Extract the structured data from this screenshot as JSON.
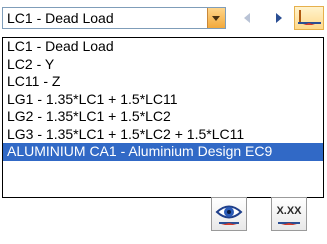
{
  "combo": {
    "selected": "LC1 - Dead Load"
  },
  "dropdown": {
    "items": [
      "LC1 - Dead Load",
      "LC2 - Y",
      "LC11 - Z",
      "LG1 - 1.35*LC1 + 1.5*LC11",
      "LG2 - 1.35*LC1 + 1.5*LC2",
      "LG3 - 1.35*LC1 + 1.5*LC2 + 1.5*LC11",
      "ALUMINIUM CA1 - Aluminium Design EC9"
    ],
    "highlighted_index": 6
  },
  "toolbar": {
    "xx_label": "X.XX",
    "icons": [
      "prev-arrow-icon",
      "next-arrow-icon",
      "result-diagram-icon",
      "eye-icon",
      "xx-values-icon"
    ]
  },
  "colors": {
    "selection": "#3169c6",
    "combo_button": "#f2a93b"
  }
}
